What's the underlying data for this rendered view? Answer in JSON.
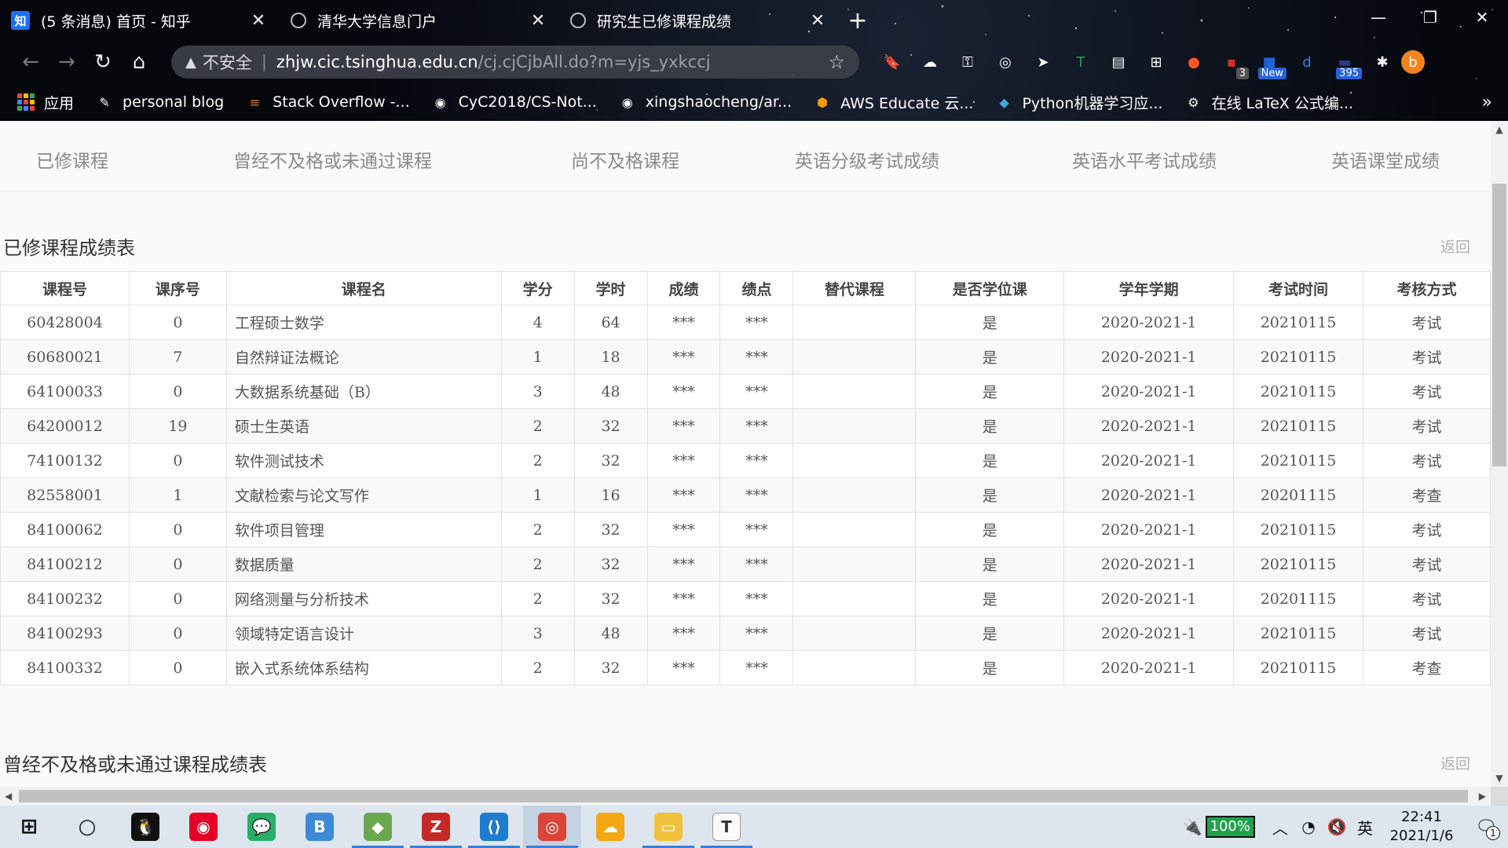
{
  "browser": {
    "tabs": [
      {
        "title": "(5 条消息) 首页 - 知乎",
        "favicon": "zhihu-icon",
        "favicon_text": "知"
      },
      {
        "title": "清华大学信息门户",
        "favicon": "globe-icon"
      },
      {
        "title": "研究生已修课程成绩",
        "favicon": "globe-icon"
      }
    ],
    "address": {
      "security_label": "不安全",
      "host": "zhjw.cic.tsinghua.edu.cn",
      "path": "/cj.cjCjbAll.do?m=yjs_yxkccj"
    },
    "extensions": [
      {
        "name": "bookmark-icon"
      },
      {
        "name": "cloud-extension-icon"
      },
      {
        "name": "vpn-extension-icon"
      },
      {
        "name": "reader-extension-icon"
      },
      {
        "name": "cursor-extension-icon"
      },
      {
        "name": "t-extension-icon",
        "color": "#1aa34a"
      },
      {
        "name": "document-extension-icon"
      },
      {
        "name": "translate-extension-icon"
      },
      {
        "name": "firefox-extension-icon",
        "color": "#ff5722"
      },
      {
        "name": "counter-extension-icon",
        "badge": "3",
        "color": "#d32f2f"
      },
      {
        "name": "new-extension-icon",
        "badge": "New",
        "color": "#1e63d6"
      },
      {
        "name": "d-extension-icon",
        "color": "#1e88e5"
      },
      {
        "name": "counter2-extension-icon",
        "badge": "395",
        "color": "#2a3b8f"
      },
      {
        "name": "puzzle-icon"
      }
    ],
    "profile_initial": "b",
    "bookmarks": [
      {
        "label": "应用",
        "icon": "apps-grid-icon"
      },
      {
        "label": "personal blog",
        "icon": "blog-icon"
      },
      {
        "label": "Stack Overflow -...",
        "icon": "stackoverflow-icon"
      },
      {
        "label": "CyC2018/CS-Not...",
        "icon": "github-icon"
      },
      {
        "label": "xingshaocheng/ar...",
        "icon": "github-icon"
      },
      {
        "label": "AWS Educate 云...",
        "icon": "aws-icon"
      },
      {
        "label": "Python机器学习应...",
        "icon": "python-icon"
      },
      {
        "label": "在线 LaTeX 公式编...",
        "icon": "gear-icon"
      }
    ]
  },
  "page": {
    "subnav": [
      "已修课程",
      "曾经不及格或未通过课程",
      "尚不及格课程",
      "英语分级考试成绩",
      "英语水平考试成绩",
      "英语课堂成绩"
    ],
    "section1_title": "已修课程成绩表",
    "back_label": "返回",
    "section2_title": "曾经不及格或未通过课程成绩表",
    "table": {
      "headers": [
        "课程号",
        "课序号",
        "课程名",
        "学分",
        "学时",
        "成绩",
        "绩点",
        "替代课程",
        "是否学位课",
        "学年学期",
        "考试时间",
        "考核方式"
      ],
      "rows": [
        [
          "60428004",
          "0",
          "工程硕士数学",
          "4",
          "64",
          "***",
          "***",
          "",
          "是",
          "2020-2021-1",
          "20210115",
          "考试"
        ],
        [
          "60680021",
          "7",
          "自然辩证法概论",
          "1",
          "18",
          "***",
          "***",
          "",
          "是",
          "2020-2021-1",
          "20210115",
          "考试"
        ],
        [
          "64100033",
          "0",
          "大数据系统基础（B）",
          "3",
          "48",
          "***",
          "***",
          "",
          "是",
          "2020-2021-1",
          "20210115",
          "考试"
        ],
        [
          "64200012",
          "19",
          "硕士生英语",
          "2",
          "32",
          "***",
          "***",
          "",
          "是",
          "2020-2021-1",
          "20210115",
          "考试"
        ],
        [
          "74100132",
          "0",
          "软件测试技术",
          "2",
          "32",
          "***",
          "***",
          "",
          "是",
          "2020-2021-1",
          "20210115",
          "考试"
        ],
        [
          "82558001",
          "1",
          "文献检索与论文写作",
          "1",
          "16",
          "***",
          "***",
          "",
          "是",
          "2020-2021-1",
          "20201115",
          "考查"
        ],
        [
          "84100062",
          "0",
          "软件项目管理",
          "2",
          "32",
          "***",
          "***",
          "",
          "是",
          "2020-2021-1",
          "20210115",
          "考试"
        ],
        [
          "84100212",
          "0",
          "数据质量",
          "2",
          "32",
          "***",
          "***",
          "",
          "是",
          "2020-2021-1",
          "20210115",
          "考试"
        ],
        [
          "84100232",
          "0",
          "网络测量与分析技术",
          "2",
          "32",
          "***",
          "***",
          "",
          "是",
          "2020-2021-1",
          "20201115",
          "考试"
        ],
        [
          "84100293",
          "0",
          "领域特定语言设计",
          "3",
          "48",
          "***",
          "***",
          "",
          "是",
          "2020-2021-1",
          "20210115",
          "考试"
        ],
        [
          "84100332",
          "0",
          "嵌入式系统体系结构",
          "2",
          "32",
          "***",
          "***",
          "",
          "是",
          "2020-2021-1",
          "20210115",
          "考查"
        ]
      ]
    }
  },
  "taskbar": {
    "apps": [
      {
        "name": "start-windows-icon"
      },
      {
        "name": "cortana-search-icon"
      },
      {
        "name": "qq-app-icon",
        "color": "#111"
      },
      {
        "name": "netease-music-app-icon",
        "color": "#e60026"
      },
      {
        "name": "wechat-app-icon",
        "color": "#2aae67"
      },
      {
        "name": "bilibili-app-icon",
        "color": "#3c8ad8"
      },
      {
        "name": "git-tool-app-icon",
        "color": "#6aa84f"
      },
      {
        "name": "filezilla-app-icon",
        "color": "#c62828"
      },
      {
        "name": "vscode-app-icon",
        "color": "#1f7bd0"
      },
      {
        "name": "chrome-app-icon",
        "color": "#db4437"
      },
      {
        "name": "cloud-app-icon",
        "color": "#f3a712"
      },
      {
        "name": "file-explorer-app-icon",
        "color": "#f2c13b"
      },
      {
        "name": "typora-app-icon",
        "color": "#fafafa"
      }
    ],
    "battery_percent": "100%",
    "ime": "英",
    "time": "22:41",
    "date": "2021/1/6",
    "notification_count": "1"
  }
}
